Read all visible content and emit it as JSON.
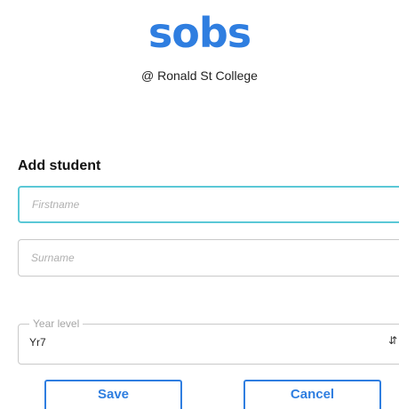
{
  "brand": {
    "logo_text": "sobs",
    "org_line": "@ Ronald St College",
    "color": "#2f7ee0"
  },
  "form": {
    "title": "Add student",
    "firstname": {
      "placeholder": "Firstname",
      "value": ""
    },
    "surname": {
      "placeholder": "Surname",
      "value": ""
    },
    "year_level": {
      "label": "Year level",
      "value": "Yr7"
    }
  },
  "actions": {
    "save_label": "Save",
    "cancel_label": "Cancel"
  },
  "colors": {
    "focus_border": "#5bc8d6",
    "border": "#c9c9c9"
  }
}
